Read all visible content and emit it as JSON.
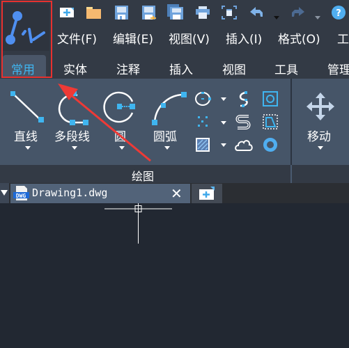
{
  "quick_access": {
    "icons": [
      "new-file-icon",
      "open-folder-icon",
      "save-icon",
      "save-as-icon",
      "save-all-icon",
      "print-icon",
      "zoom-extents-icon",
      "undo-icon",
      "undo-dropdown-icon",
      "redo-icon",
      "redo-dropdown-icon",
      "help-icon"
    ]
  },
  "menu": {
    "items": [
      {
        "label": "文件(F)"
      },
      {
        "label": "编辑(E)"
      },
      {
        "label": "视图(V)"
      },
      {
        "label": "插入(I)"
      },
      {
        "label": "格式(O)"
      },
      {
        "label": "工"
      }
    ]
  },
  "ribbon_tabs": [
    {
      "label": "常用",
      "active": true
    },
    {
      "label": "实体"
    },
    {
      "label": "注释"
    },
    {
      "label": "插入"
    },
    {
      "label": "视图"
    },
    {
      "label": "工具"
    },
    {
      "label": "管理"
    }
  ],
  "draw_panel": {
    "title": "绘图",
    "tools": [
      {
        "label": "直线",
        "icon": "line-icon"
      },
      {
        "label": "多段线",
        "icon": "polyline-icon"
      },
      {
        "label": "圆",
        "icon": "circle-icon"
      },
      {
        "label": "圆弧",
        "icon": "arc-icon"
      }
    ],
    "small_tools": [
      "ellipse-icon",
      "point-icon",
      "hatch-icon",
      "spline-icon",
      "revcloud-s-icon",
      "revcloud-icon",
      "region-icon",
      "wipeout-icon",
      "donut-icon"
    ]
  },
  "modify_panel": {
    "tools": [
      {
        "label": "移动",
        "icon": "move-icon"
      }
    ]
  },
  "document_tabs": [
    {
      "title": "Drawing1.dwg",
      "active": true
    }
  ],
  "colors": {
    "accent": "#3fb5f0",
    "highlight": "#e8312f",
    "ribbon_bg": "#465568",
    "canvas_bg": "#222832"
  }
}
